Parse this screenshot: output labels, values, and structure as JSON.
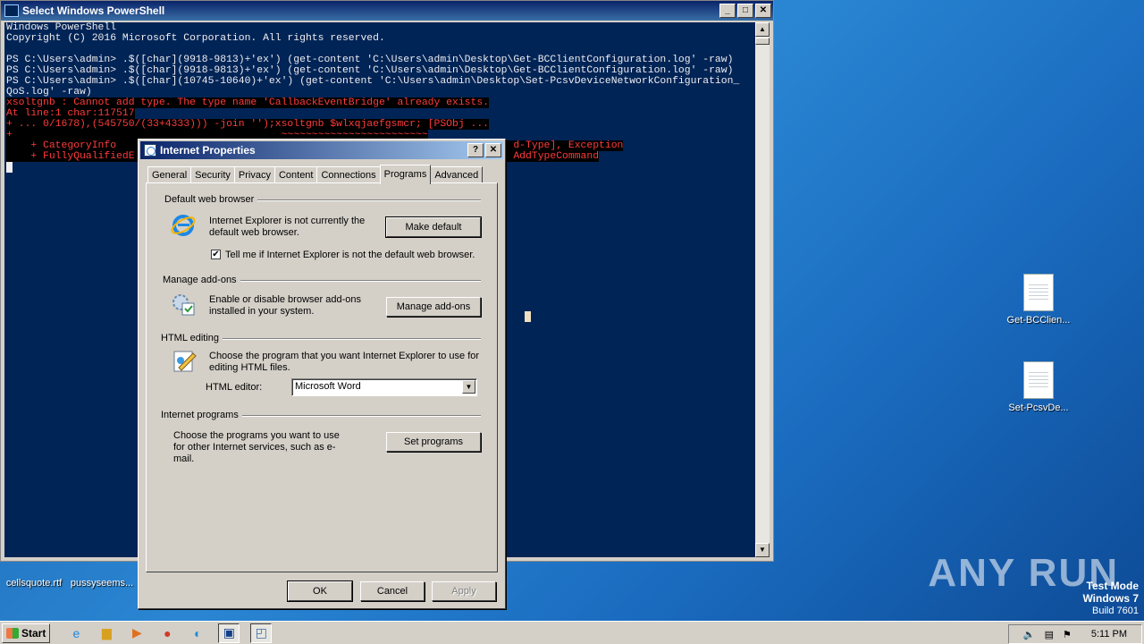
{
  "desktop": {
    "icons": [
      {
        "label": "Get-BCClien..."
      },
      {
        "label": "Set-PcsvDe..."
      }
    ],
    "bottom_icons": [
      {
        "label": "cellsquote.rtf"
      },
      {
        "label": "pussyseems..."
      }
    ],
    "watermark": "ANY RUN",
    "test_mode": {
      "line1": "Test Mode",
      "line2": "Windows 7",
      "line3": "Build 7601"
    }
  },
  "powershell": {
    "title": "Select Windows PowerShell",
    "lines": [
      "Windows PowerShell",
      "Copyright (C) 2016 Microsoft Corporation. All rights reserved.",
      "",
      "PS C:\\Users\\admin> .$([char](9918-9813)+'ex') (get-content 'C:\\Users\\admin\\Desktop\\Get-BCClientConfiguration.log' -raw)",
      "PS C:\\Users\\admin> .$([char](9918-9813)+'ex') (get-content 'C:\\Users\\admin\\Desktop\\Get-BCClientConfiguration.log' -raw)",
      "PS C:\\Users\\admin> .$([char](10745-10640)+'ex') (get-content 'C:\\Users\\admin\\Desktop\\Set-PcsvDeviceNetworkConfiguration_",
      "QoS.log' -raw)"
    ],
    "error_lines": [
      "xsoltgnb : Cannot add type. The type name 'CallbackEventBridge' already exists.",
      "At line:1 char:117517",
      "+ ... 0/1678),(545750/(33+4333))) -join '');xsoltgnb $wlxqjaefgsmcr; [PSObj ...",
      "+                                            ~~~~~~~~~~~~~~~~~~~~~~~~",
      "    + CategoryInfo                                                                 d-Type], Exception",
      "    + FullyQualifiedE                                                              AddTypeCommand"
    ]
  },
  "dialog": {
    "title": "Internet Properties",
    "help_glyph": "?",
    "close_glyph": "✕",
    "tabs": [
      "General",
      "Security",
      "Privacy",
      "Content",
      "Connections",
      "Programs",
      "Advanced"
    ],
    "active_tab": "Programs",
    "default_browser": {
      "section": "Default web browser",
      "text": "Internet Explorer is not currently the default web browser.",
      "button": "Make default",
      "checkbox_label": "Tell me if Internet Explorer is not the default web browser.",
      "checked": true
    },
    "addons": {
      "section": "Manage add-ons",
      "text": "Enable or disable browser add-ons installed in your system.",
      "button": "Manage add-ons"
    },
    "html_editing": {
      "section": "HTML editing",
      "text": "Choose the program that you want Internet Explorer to use for editing HTML files.",
      "editor_label": "HTML editor:",
      "editor_value": "Microsoft Word"
    },
    "internet_programs": {
      "section": "Internet programs",
      "text": "Choose the programs you want to use for other Internet services, such as e-mail.",
      "button": "Set programs"
    },
    "ok": "OK",
    "cancel": "Cancel",
    "apply": "Apply"
  },
  "taskbar": {
    "start": "Start",
    "clock": "5:11 PM"
  }
}
